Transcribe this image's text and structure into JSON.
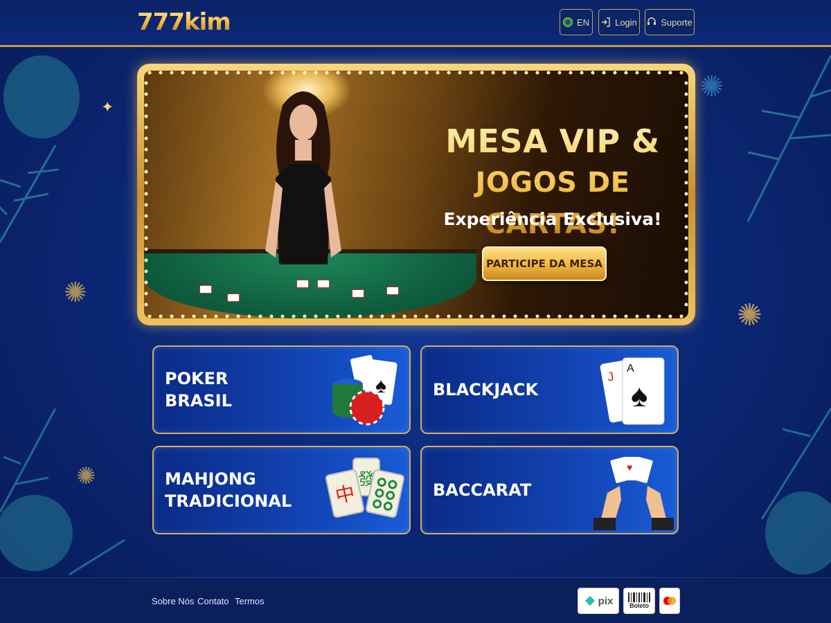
{
  "header": {
    "logo": "777kim",
    "lang_label": "EN",
    "login_label": "Login",
    "support_label": "Suporte"
  },
  "banner": {
    "title_line1": "MESA VIP &",
    "title_line2": "JOGOS DE CARTAS!",
    "subtitle": "Experiência Exclusiva!",
    "cta_label": "PARTICIPE DA MESA"
  },
  "games": [
    {
      "line1": "POKER",
      "line2": "BRASIL",
      "icon": "poker-chips-cards-icon"
    },
    {
      "line1": "BLACKJACK",
      "line2": "",
      "icon": "blackjack-cards-icon"
    },
    {
      "line1": "MAHJONG",
      "line2": "TRADICIONAL",
      "icon": "mahjong-tiles-icon"
    },
    {
      "line1": "BACCARAT",
      "line2": "",
      "icon": "baccarat-hands-icon"
    }
  ],
  "footer": {
    "links": [
      "Sobre Nós",
      "Contato",
      "Termos"
    ],
    "payments": [
      {
        "label": "pix",
        "icon": "pix-logo-icon"
      },
      {
        "label": "Boleto",
        "icon": "boleto-barcode-icon"
      },
      {
        "label": "",
        "icon": "mastercard-logo-icon"
      }
    ]
  },
  "colors": {
    "background": "#0b2878",
    "gold": "#f2c04a",
    "gold_border": "#d6ad5a",
    "tile_blue": "#1244b4"
  }
}
